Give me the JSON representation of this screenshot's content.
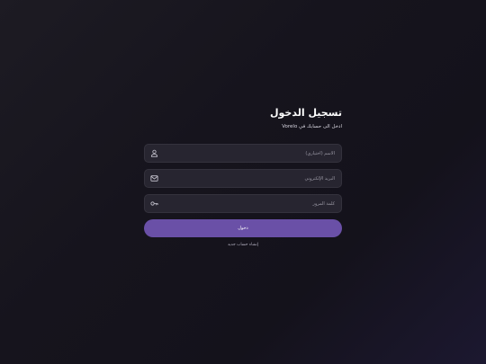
{
  "login": {
    "title": "تسجيل الدخول",
    "subtitle": "ادخل الى حسابك في Vorelo",
    "fields": [
      {
        "placeholder": "الاسم (اختياري)",
        "icon": "user-icon"
      },
      {
        "placeholder": "البريد الإلكتروني",
        "icon": "mail-icon"
      },
      {
        "placeholder": "كلمة المرور",
        "icon": "key-icon"
      }
    ],
    "submit_label": "دخول",
    "create_account_link": "إنشاء حساب جديد"
  },
  "colors": {
    "background": "#16141d",
    "field_bg": "#272530",
    "accent": "#6a50a7"
  }
}
